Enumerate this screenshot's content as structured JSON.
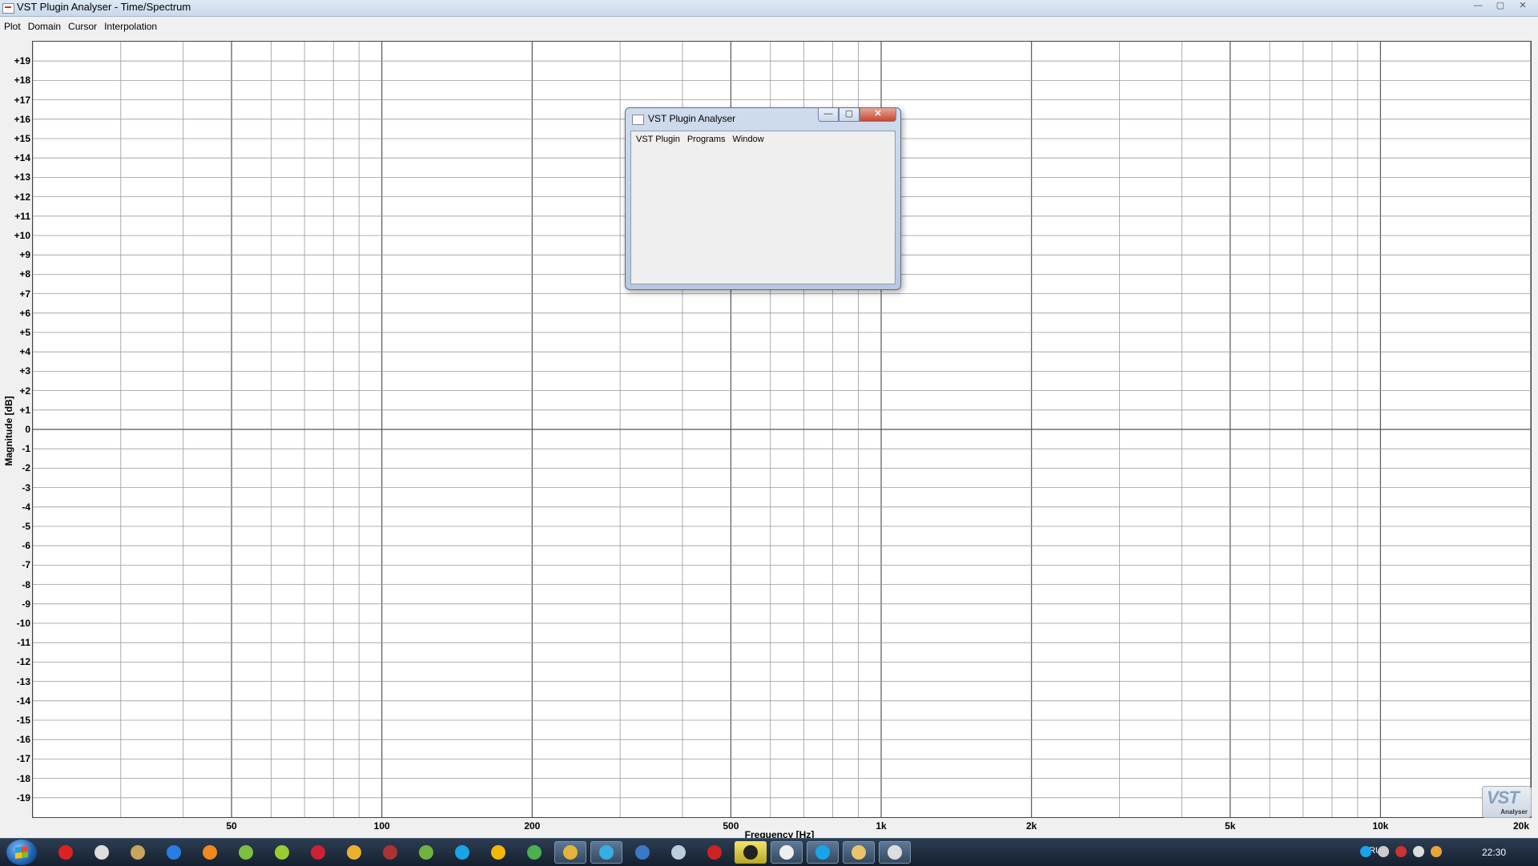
{
  "window": {
    "title": "VST Plugin Analyser - Time/Spectrum",
    "controls": {
      "minimize": "—",
      "maximize": "▢",
      "close": "✕"
    }
  },
  "menu": {
    "items": [
      "Plot",
      "Domain",
      "Cursor",
      "Interpolation"
    ]
  },
  "chart_data": {
    "type": "line",
    "series": [],
    "ylabel": "Magnitude [dB]",
    "xlabel": "Frequency [Hz]",
    "xscale": "log",
    "xlim": [
      20,
      20000
    ],
    "ylim": [
      -20,
      20
    ],
    "grid": true,
    "y_ticks": [
      "+19",
      "+18",
      "+17",
      "+16",
      "+15",
      "+14",
      "+13",
      "+12",
      "+11",
      "+10",
      "+9",
      "+8",
      "+7",
      "+6",
      "+5",
      "+4",
      "+3",
      "+2",
      "+1",
      "0",
      "-1",
      "-2",
      "-3",
      "-4",
      "-5",
      "-6",
      "-7",
      "-8",
      "-9",
      "-10",
      "-11",
      "-12",
      "-13",
      "-14",
      "-15",
      "-16",
      "-17",
      "-18",
      "-19"
    ],
    "y_tick_values": [
      19,
      18,
      17,
      16,
      15,
      14,
      13,
      12,
      11,
      10,
      9,
      8,
      7,
      6,
      5,
      4,
      3,
      2,
      1,
      0,
      -1,
      -2,
      -3,
      -4,
      -5,
      -6,
      -7,
      -8,
      -9,
      -10,
      -11,
      -12,
      -13,
      -14,
      -15,
      -16,
      -17,
      -18,
      -19
    ],
    "x_ticks": [
      {
        "label": "50",
        "value": 50
      },
      {
        "label": "100",
        "value": 100
      },
      {
        "label": "200",
        "value": 200
      },
      {
        "label": "500",
        "value": 500
      },
      {
        "label": "1k",
        "value": 1000
      },
      {
        "label": "2k",
        "value": 2000
      },
      {
        "label": "5k",
        "value": 5000
      },
      {
        "label": "10k",
        "value": 10000
      },
      {
        "label": "20k",
        "value": 20000
      }
    ]
  },
  "logo": {
    "big": "VST",
    "small": "Analyser"
  },
  "dialog": {
    "title": "VST Plugin Analyser",
    "menu": [
      "VST Plugin",
      "Programs",
      "Window"
    ],
    "controls": {
      "minimize": "—",
      "maximize": "▢",
      "close": "✕"
    }
  },
  "taskbar": {
    "language": "RU",
    "clock": "22:30",
    "tasks": [
      {
        "name": "record",
        "color": "#d22"
      },
      {
        "name": "mouse",
        "color": "#ddd"
      },
      {
        "name": "folder-app",
        "color": "#c9a45c"
      },
      {
        "name": "thunder",
        "color": "#2a7de1"
      },
      {
        "name": "orange-app",
        "color": "#f08a1c"
      },
      {
        "name": "green-app",
        "color": "#7bc043"
      },
      {
        "name": "arrow-app",
        "color": "#9c3"
      },
      {
        "name": "red-app",
        "color": "#c23"
      },
      {
        "name": "yellow-app",
        "color": "#e8b130"
      },
      {
        "name": "rec-app",
        "color": "#a33"
      },
      {
        "name": "torrent",
        "color": "#6fb23f"
      },
      {
        "name": "skype",
        "color": "#1aa3e8"
      },
      {
        "name": "warning-app",
        "color": "#f2b705"
      },
      {
        "name": "shield-app",
        "color": "#4caf50"
      },
      {
        "name": "chrome",
        "color": "#e2b43b",
        "active": true
      },
      {
        "name": "telegram",
        "color": "#37aee2",
        "active": true
      },
      {
        "name": "calendar",
        "color": "#3b78c7"
      },
      {
        "name": "bird-app",
        "color": "#bcd"
      },
      {
        "name": "red-square",
        "color": "#c22"
      },
      {
        "name": "clapper",
        "color": "#222",
        "highlight": true
      },
      {
        "name": "clock-app",
        "color": "#eee",
        "active": true
      },
      {
        "name": "skype-2",
        "color": "#1aa3e8",
        "active": true
      },
      {
        "name": "explorer",
        "color": "#e9c46a",
        "active": true
      },
      {
        "name": "vst-analyser",
        "color": "#ddd",
        "active": true
      }
    ],
    "tray": [
      {
        "name": "skype-tray",
        "color": "#1aa3e8"
      },
      {
        "name": "ccleaner-tray",
        "color": "#ccc"
      },
      {
        "name": "network-tray",
        "color": "#c33"
      },
      {
        "name": "volume-tray",
        "color": "#ddd"
      },
      {
        "name": "globe-tray",
        "color": "#e8a33b"
      }
    ]
  }
}
